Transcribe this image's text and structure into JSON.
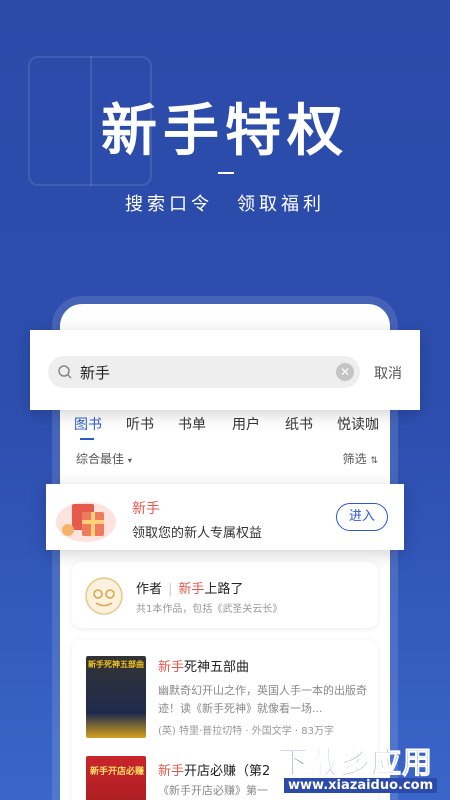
{
  "hero": {
    "title": "新手特权",
    "sub_left": "搜索口令",
    "sub_right": "领取福利"
  },
  "search": {
    "query": "新手",
    "cancel_label": "取消"
  },
  "tabs": [
    {
      "label": "图书",
      "active": true
    },
    {
      "label": "听书"
    },
    {
      "label": "书单"
    },
    {
      "label": "用户"
    },
    {
      "label": "纸书"
    },
    {
      "label": "悦读咖"
    }
  ],
  "sort": {
    "left": "综合最佳",
    "right": "筛选"
  },
  "promo": {
    "title": "新手",
    "desc": "领取您的新人专属权益",
    "button": "进入"
  },
  "author": {
    "label": "作者",
    "name_hl": "新手",
    "name_rest": "上路了",
    "sub": "共1本作品，包括《武圣关云长》"
  },
  "books": [
    {
      "title_hl": "新手",
      "title_rest": "死神五部曲",
      "desc": "幽默奇幻开山之作，英国人手一本的出版奇迹！读《新手死神》就像看一场...",
      "meta": "(英) 特里·普拉切特 · 外国文学 · 83万字",
      "cover_text": "新手死神五部曲"
    },
    {
      "title_hl": "新手",
      "title_rest": "开店必赚（第2",
      "desc": "《新手开店必赚》第一",
      "cover_text": "新手开店必赚"
    }
  ],
  "watermark": {
    "main": "下载多应用",
    "sub": "www.xiazaiduo.com"
  },
  "colors": {
    "background": "#2c4aa8",
    "accent": "#2b5ad0",
    "highlight": "#e15a4e"
  }
}
